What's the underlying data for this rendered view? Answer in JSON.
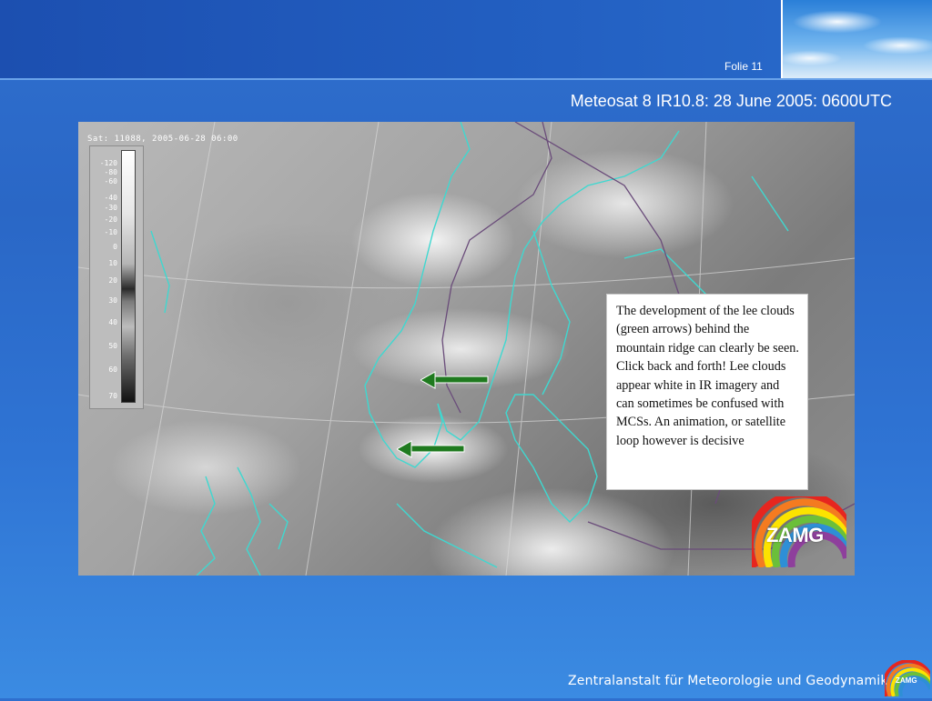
{
  "header": {
    "slide_number": "Folie 11",
    "title": "Meteosat 8 IR10.8: 28 June 2005: 0600UTC"
  },
  "image": {
    "sat_header": "Sat: 11088, 2005-06-28 06:00",
    "scale_labels": [
      "-120",
      "-80",
      "-60",
      "-40",
      "-30",
      "-20",
      "-10",
      "0",
      "10",
      "20",
      "30",
      "40",
      "50",
      "60",
      "70"
    ]
  },
  "info_box": {
    "text": "The development of the lee clouds (green arrows) behind the mountain ridge can clearly be seen. Click back and forth!  Lee clouds appear white in IR imagery and can sometimes be confused with MCSs. An animation, or satellite loop however is decisive"
  },
  "logo": {
    "text": "ZAMG"
  },
  "footer": {
    "text": "Zentralanstalt für Meteorologie und Geodynamik",
    "logo_text": "ZAMG"
  },
  "colors": {
    "background": "#2a67c6",
    "arrow": "#1f7a1f",
    "coastline": "#3fd8d0",
    "border_line": "#6a4c7a"
  }
}
